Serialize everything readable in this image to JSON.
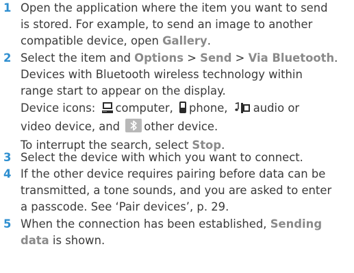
{
  "steps": [
    {
      "number": "1",
      "lines": [
        {
          "parts": [
            "Open the application where the item you want to send"
          ]
        },
        {
          "parts": [
            "is stored. For example, to send an image to another"
          ]
        },
        {
          "parts": [
            "compatible device, open ",
            "Gallery",
            "."
          ]
        }
      ]
    },
    {
      "number": "2",
      "lines": [
        {
          "parts": [
            "Select the item and ",
            "Options",
            " > ",
            "Send",
            " > ",
            "Via Bluetooth",
            "."
          ]
        },
        {
          "parts": [
            "Devices with Bluetooth wireless technology within"
          ]
        },
        {
          "parts": [
            "range start to appear on the display."
          ]
        },
        {
          "parts": [
            "Device icons: ",
            "computer, ",
            "phone, ",
            "audio or"
          ]
        },
        {
          "parts": [
            "video device, and ",
            "other device."
          ]
        },
        {
          "parts": [
            "To interrupt the search, select ",
            "Stop",
            "."
          ]
        }
      ]
    },
    {
      "number": "3",
      "lines": [
        {
          "parts": [
            "Select the device with which you want to connect."
          ]
        }
      ]
    },
    {
      "number": "4",
      "lines": [
        {
          "parts": [
            "If the other device requires pairing before data can be"
          ]
        },
        {
          "parts": [
            "transmitted, a tone sounds, and you are asked to enter"
          ]
        },
        {
          "parts": [
            "a passcode. See ‘Pair devices’, p. 29."
          ]
        }
      ]
    },
    {
      "number": "5",
      "lines": [
        {
          "parts": [
            "When the connection has been established, ",
            "Sending"
          ]
        },
        {
          "parts": [
            "data",
            " is shown."
          ]
        }
      ]
    }
  ],
  "colors": {
    "step_number": "#2f8fd0",
    "highlight": "#8a8a8a",
    "text": "#3a3a3a"
  },
  "icons": [
    "computer-icon",
    "phone-icon",
    "audio-video-icon",
    "bluetooth-icon"
  ]
}
